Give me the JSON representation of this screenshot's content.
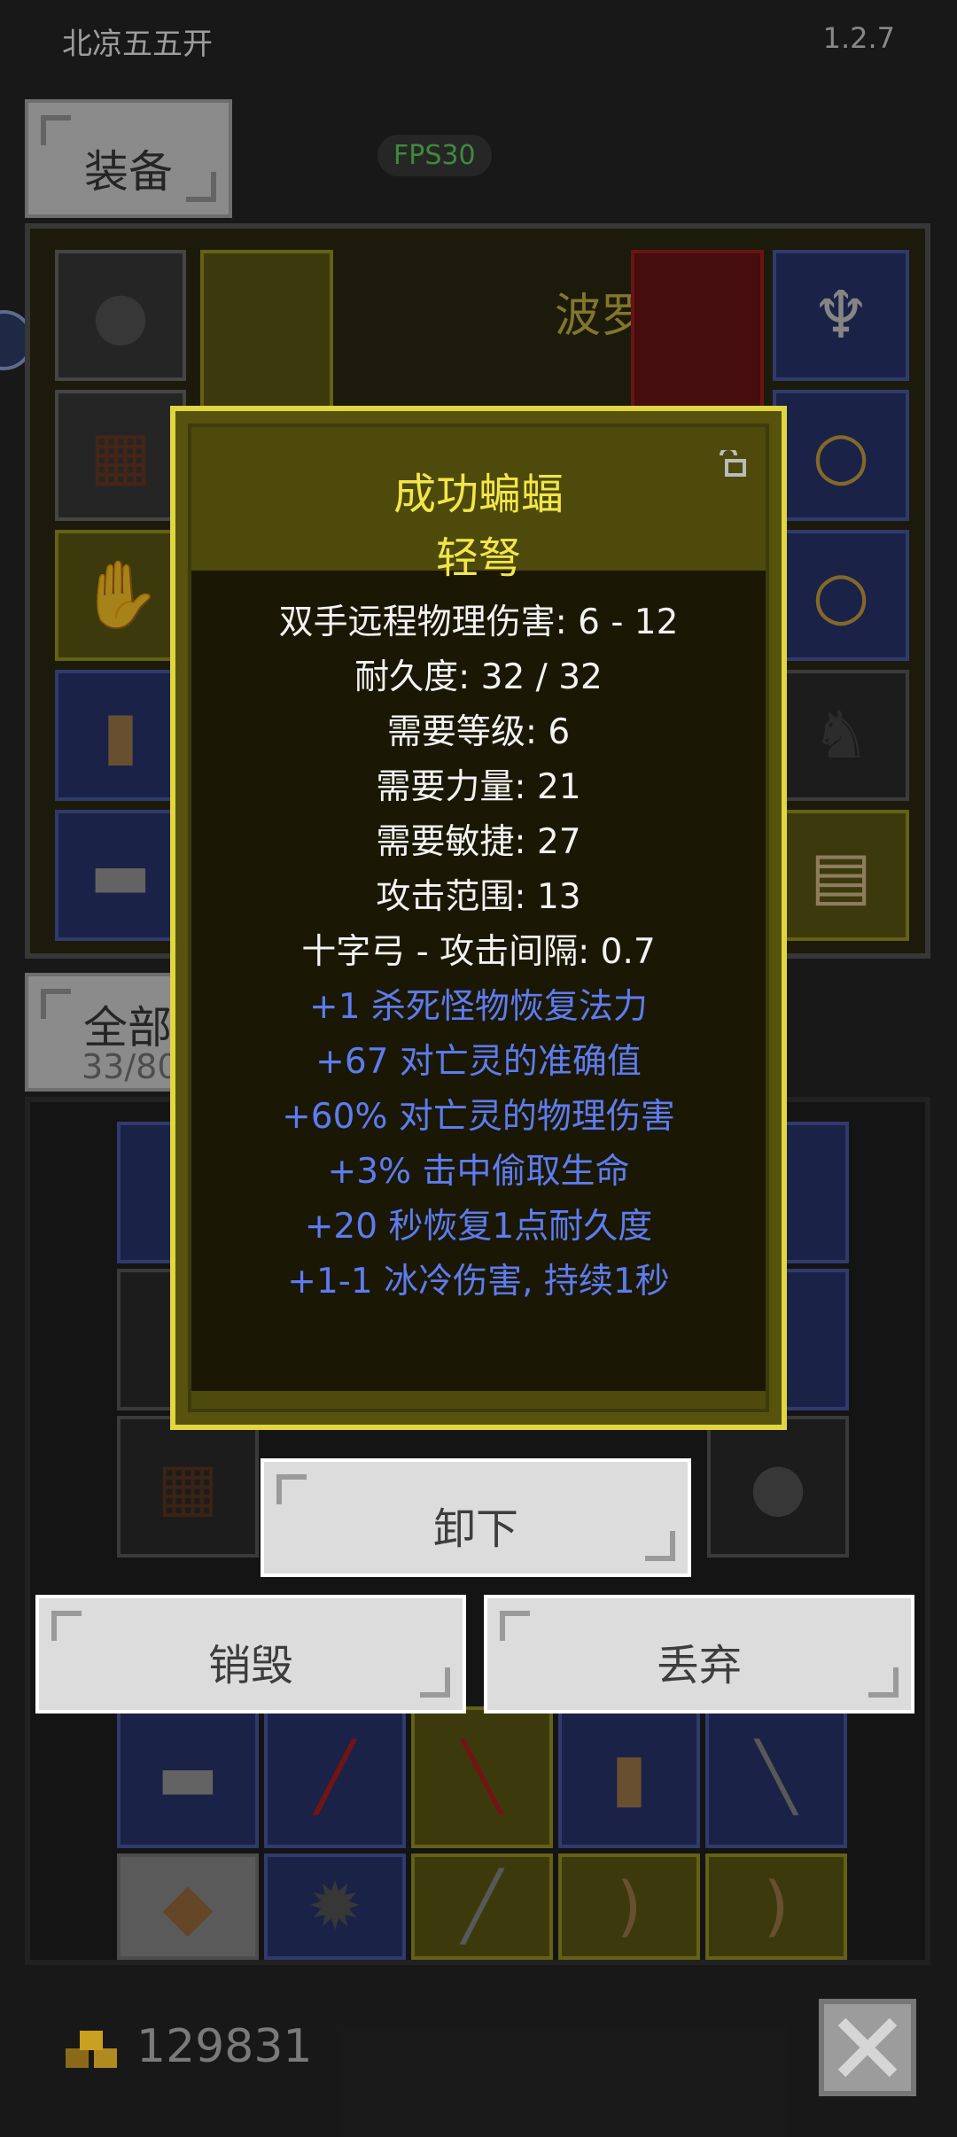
{
  "header": {
    "app_title": "北凉五五开",
    "version": "1.2.7"
  },
  "tabs": {
    "equipment_label": "装备",
    "all_label": "全部",
    "all_count": "33/80"
  },
  "fps": "FPS30",
  "equip_panel": {
    "partial_name": "波罗"
  },
  "tooltip": {
    "name": "成功蝙蝠",
    "type": "轻弩",
    "stats": [
      "双手远程物理伤害: 6 - 12",
      "耐久度: 32 / 32",
      "需要等级: 6",
      "需要力量: 21",
      "需要敏捷: 27",
      "攻击范围: 13",
      "十字弓 - 攻击间隔: 0.7"
    ],
    "affixes": [
      "+1 杀死怪物恢复法力",
      "+67 对亡灵的准确值",
      "+60% 对亡灵的物理伤害",
      "+3% 击中偷取生命",
      "+20 秒恢复1点耐久度",
      "+1-1 冰冷伤害, 持续1秒"
    ]
  },
  "actions": {
    "unequip": "卸下",
    "destroy": "销毁",
    "discard": "丢弃"
  },
  "footer": {
    "gold": "129831"
  },
  "colors": {
    "item_name": "#f2e64a",
    "affix": "#5e7cf0",
    "fps": "#5cd65c"
  }
}
